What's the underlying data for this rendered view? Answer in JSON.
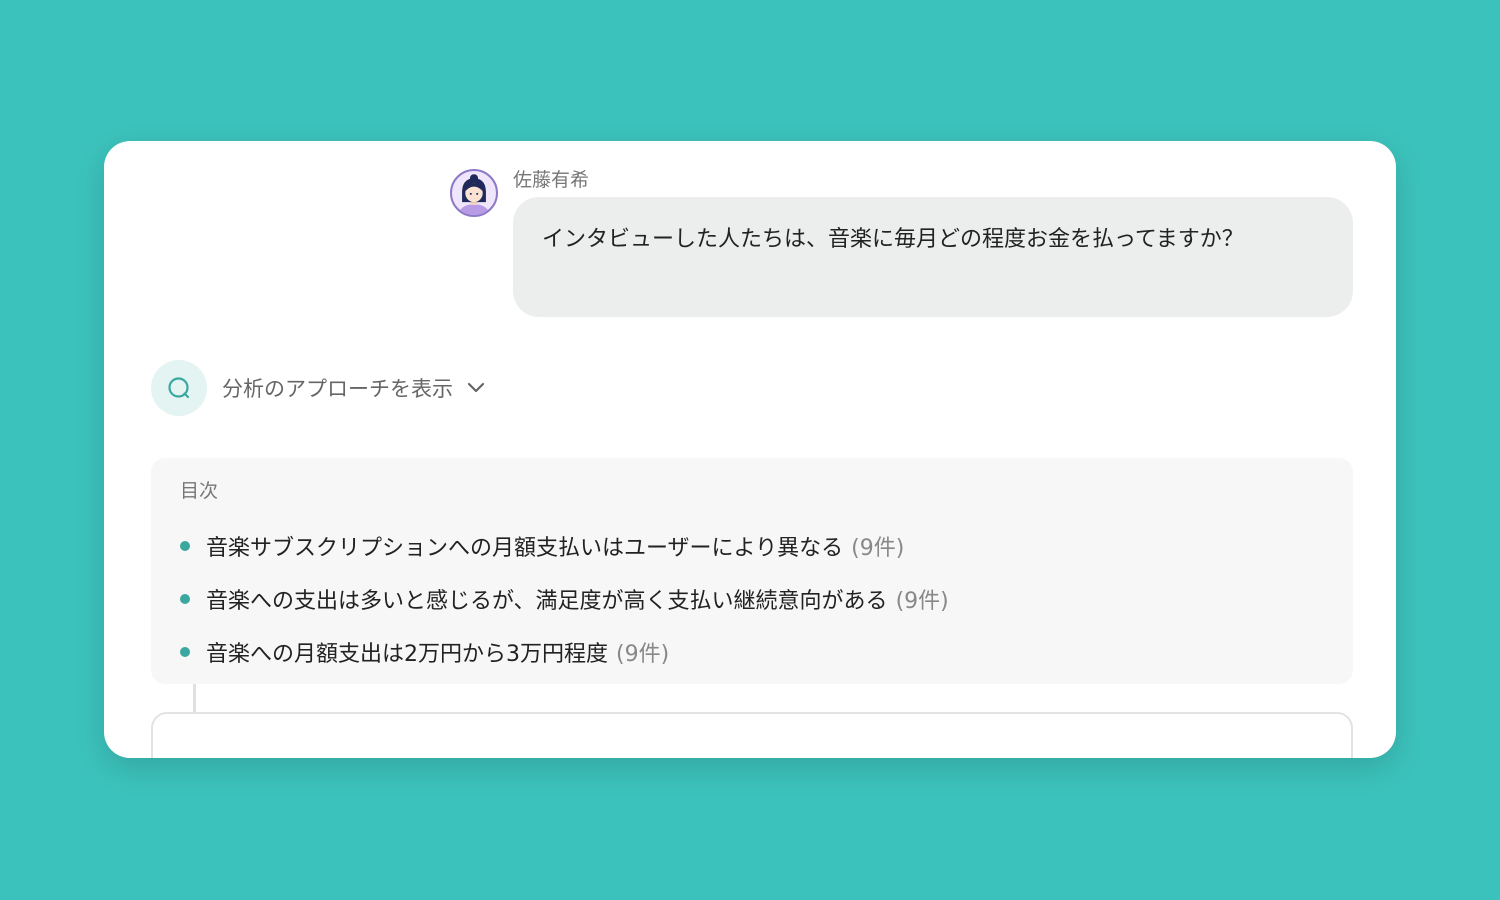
{
  "user": {
    "name": "佐藤有希",
    "message": "インタビューした人たちは、音楽に毎月どの程度お金を払ってますか？"
  },
  "approach": {
    "label": "分析のアプローチを表示",
    "icon": "search-icon"
  },
  "toc": {
    "title": "目次",
    "items": [
      {
        "text": "音楽サブスクリプションへの月額支払いはユーザーにより異なる",
        "count": "(9件)"
      },
      {
        "text": "音楽への支出は多いと感じるが、満足度が高く支払い継続意向がある",
        "count": "(9件)"
      },
      {
        "text": "音楽への月額支出は2万円から3万円程度",
        "count": "(9件)"
      }
    ]
  },
  "colors": {
    "background": "#3cc2bc",
    "accent": "#3aa89f",
    "bubble": "#eceeed",
    "toc_bg": "#f7f7f7"
  }
}
